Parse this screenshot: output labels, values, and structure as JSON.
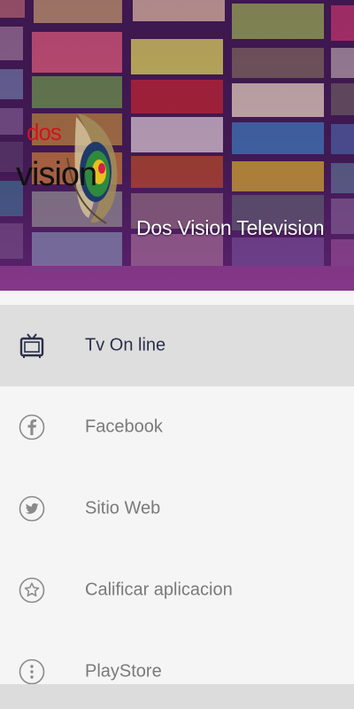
{
  "header": {
    "logo_word_top": "dos",
    "logo_word_bottom": "vision",
    "title": "Dos Vision Television"
  },
  "menu": {
    "items": [
      {
        "label": "Tv On line",
        "icon": "tv-icon",
        "active": true
      },
      {
        "label": "Facebook",
        "icon": "facebook-icon",
        "active": false
      },
      {
        "label": "Sitio Web",
        "icon": "twitter-icon",
        "active": false
      },
      {
        "label": "Calificar aplicacion",
        "icon": "star-icon",
        "active": false
      },
      {
        "label": "PlayStore",
        "icon": "more-vertical-icon",
        "active": false
      }
    ]
  },
  "colors": {
    "active_item_bg": "#dedede",
    "active_label": "#2b2f4a",
    "inactive_label": "#7a7a7a",
    "logo_red": "#d4141c"
  }
}
